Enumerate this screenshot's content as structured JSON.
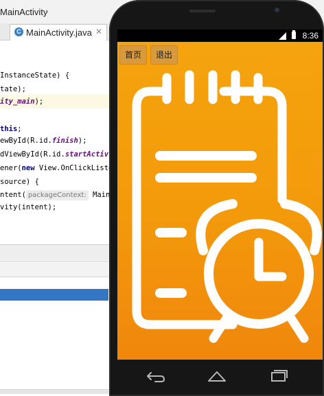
{
  "ide": {
    "breadcrumb": "MainActivity",
    "tab": {
      "label": "MainActivity.java",
      "icon": "class-icon"
    },
    "code_lines": [
      {
        "pre": "",
        "parts": [
          {
            "t": "InstanceState) {",
            "c": ""
          }
        ]
      },
      {
        "pre": "",
        "parts": [
          {
            "t": "tate);",
            "c": ""
          }
        ]
      },
      {
        "pre": "",
        "parts": [
          {
            "t": "ity_main",
            "c": "it"
          },
          {
            "t": ");",
            "c": ""
          }
        ],
        "highlight": true
      },
      {
        "pre": "",
        "parts": []
      },
      {
        "pre": "",
        "parts": [
          {
            "t": "this",
            "c": "kw"
          },
          {
            "t": ";",
            "c": ""
          }
        ]
      },
      {
        "pre": "",
        "parts": [
          {
            "t": "ewById(R.id.",
            "c": ""
          },
          {
            "t": "finish",
            "c": "it"
          },
          {
            "t": ");",
            "c": ""
          }
        ]
      },
      {
        "pre": "",
        "parts": [
          {
            "t": "dViewById(R.id.",
            "c": ""
          },
          {
            "t": "startActiv",
            "c": "it"
          }
        ]
      },
      {
        "pre": "",
        "parts": [
          {
            "t": "ener(",
            "c": ""
          },
          {
            "t": "new",
            "c": "kw"
          },
          {
            "t": " View.OnClickListe",
            "c": ""
          }
        ]
      },
      {
        "pre": "",
        "parts": [
          {
            "t": "source) {",
            "c": ""
          }
        ]
      },
      {
        "pre": "",
        "parts": [
          {
            "t": "ntent(",
            "c": ""
          },
          {
            "t": "packageContext:",
            "c": "hint"
          },
          {
            "t": " Main",
            "c": ""
          }
        ]
      },
      {
        "pre": "",
        "parts": [
          {
            "t": "vity(intent);",
            "c": ""
          }
        ]
      }
    ]
  },
  "phone": {
    "status": {
      "time": "8:36"
    },
    "actions": {
      "home_label": "首页",
      "exit_label": "退出"
    },
    "colors": {
      "screen_top": "#f5a40e",
      "screen_bottom": "#f0870c",
      "logo": "#ffffff"
    },
    "nav_keys": [
      "back-icon",
      "home-icon",
      "recents-icon"
    ]
  }
}
